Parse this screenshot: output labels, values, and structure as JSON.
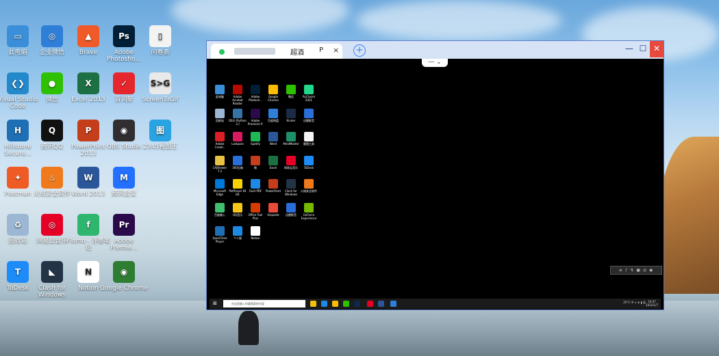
{
  "desktop": {
    "icons": [
      {
        "label": "此电脑",
        "color": "#3a8fd8",
        "glyph": "▭"
      },
      {
        "label": "企业微信",
        "color": "#2f7fd9",
        "glyph": "◎"
      },
      {
        "label": "Brave",
        "color": "#f05a28",
        "glyph": "▲"
      },
      {
        "label": "Adobe Photosho...",
        "color": "#001e36",
        "glyph": "Ps"
      },
      {
        "label": "问卷表",
        "color": "#f3f3f3",
        "glyph": "▯"
      },
      {
        "label": "Visual Studio Code",
        "color": "#2489ca",
        "glyph": "❮❯"
      },
      {
        "label": "微信",
        "color": "#2dc100",
        "glyph": "●"
      },
      {
        "label": "Excel 2013",
        "color": "#1d7044",
        "glyph": "X"
      },
      {
        "label": "百词斩",
        "color": "#e5262d",
        "glyph": "✓"
      },
      {
        "label": "ScreenToGif",
        "color": "#e9e9e9",
        "glyph": "S>G"
      },
      {
        "label": "Hillstone Secure...",
        "color": "#1f6fb5",
        "glyph": "H"
      },
      {
        "label": "腾讯QQ",
        "color": "#111111",
        "glyph": "Q"
      },
      {
        "label": "PowerPoint 2013",
        "color": "#c43e1c",
        "glyph": "P"
      },
      {
        "label": "OBS Studio",
        "color": "#302e31",
        "glyph": "◉"
      },
      {
        "label": "2345看图王",
        "color": "#2aa3e2",
        "glyph": "图"
      },
      {
        "label": "Postman",
        "color": "#ef5b25",
        "glyph": "✦"
      },
      {
        "label": "火绒安全软件",
        "color": "#f07a1b",
        "glyph": "♨"
      },
      {
        "label": "Word 2013",
        "color": "#2b579a",
        "glyph": "W"
      },
      {
        "label": "腾讯会议",
        "color": "#2370ff",
        "glyph": "M"
      },
      {
        "label": "回收站",
        "color": "#9bb7d4",
        "glyph": "♻"
      },
      {
        "label": "网易云音乐",
        "color": "#e60026",
        "glyph": "◎"
      },
      {
        "label": "Flomo - 浮墨笔记",
        "color": "#2fb66e",
        "glyph": "f"
      },
      {
        "label": "Adobe Premie...",
        "color": "#2a0a4a",
        "glyph": "Pr"
      },
      {
        "label": "ToDesk",
        "color": "#1d8cf8",
        "glyph": "T"
      },
      {
        "label": "Clash for Windows",
        "color": "#243447",
        "glyph": "◣"
      },
      {
        "label": "Notion",
        "color": "#ffffff",
        "glyph": "N"
      },
      {
        "label": "Google Chrome",
        "color": "#2e7d32",
        "glyph": "◉"
      }
    ]
  },
  "window": {
    "tab_title": "超酒",
    "tab_extra": "P",
    "tab_close": "×",
    "new_tab": "+",
    "minimize": "—",
    "maximize": "☐",
    "close": "✕",
    "drop_control": "— ⌄"
  },
  "remote": {
    "icons": [
      "此电脑",
      "Adobe Acrobat Reader",
      "Adobe Photosh...",
      "Google Chrome",
      "微信",
      "PyCharm 2021",
      "回收站",
      "IDLE (Python 3.)",
      "Adobe Premiere P.",
      "百度网盘",
      "Kinder",
      "迅雷影音",
      "Adobe Creati..",
      "Lastpass",
      "Spotify",
      "Word",
      "MindMaster",
      "截图工具",
      "CAJViewer 7.2",
      "360压缩",
      "微",
      "Excel",
      "网易云音乐",
      "ToDesk",
      "Microsoft Edge",
      "PotPlayer 64 bit",
      "Foxit PDF",
      "PowerPoint",
      "Clash for Windows",
      "火绒安全软件",
      "百度输入",
      "QQ音乐",
      "Office Tool Plus",
      "Snipaste",
      "迅雷影音",
      "GeForce Experience",
      "QuickTime Player",
      "个人版",
      "Notion"
    ],
    "taskbar": {
      "start": "⊞",
      "search_placeholder": "在这里输入你要搜索的内容",
      "tray": "25°C 中 ∧ ⊕ ▮ 英",
      "time": "19:07",
      "date": "2022/1/7"
    },
    "float_toolbar": "≡ ♪ ↯ ▣ ◎ ◉"
  }
}
